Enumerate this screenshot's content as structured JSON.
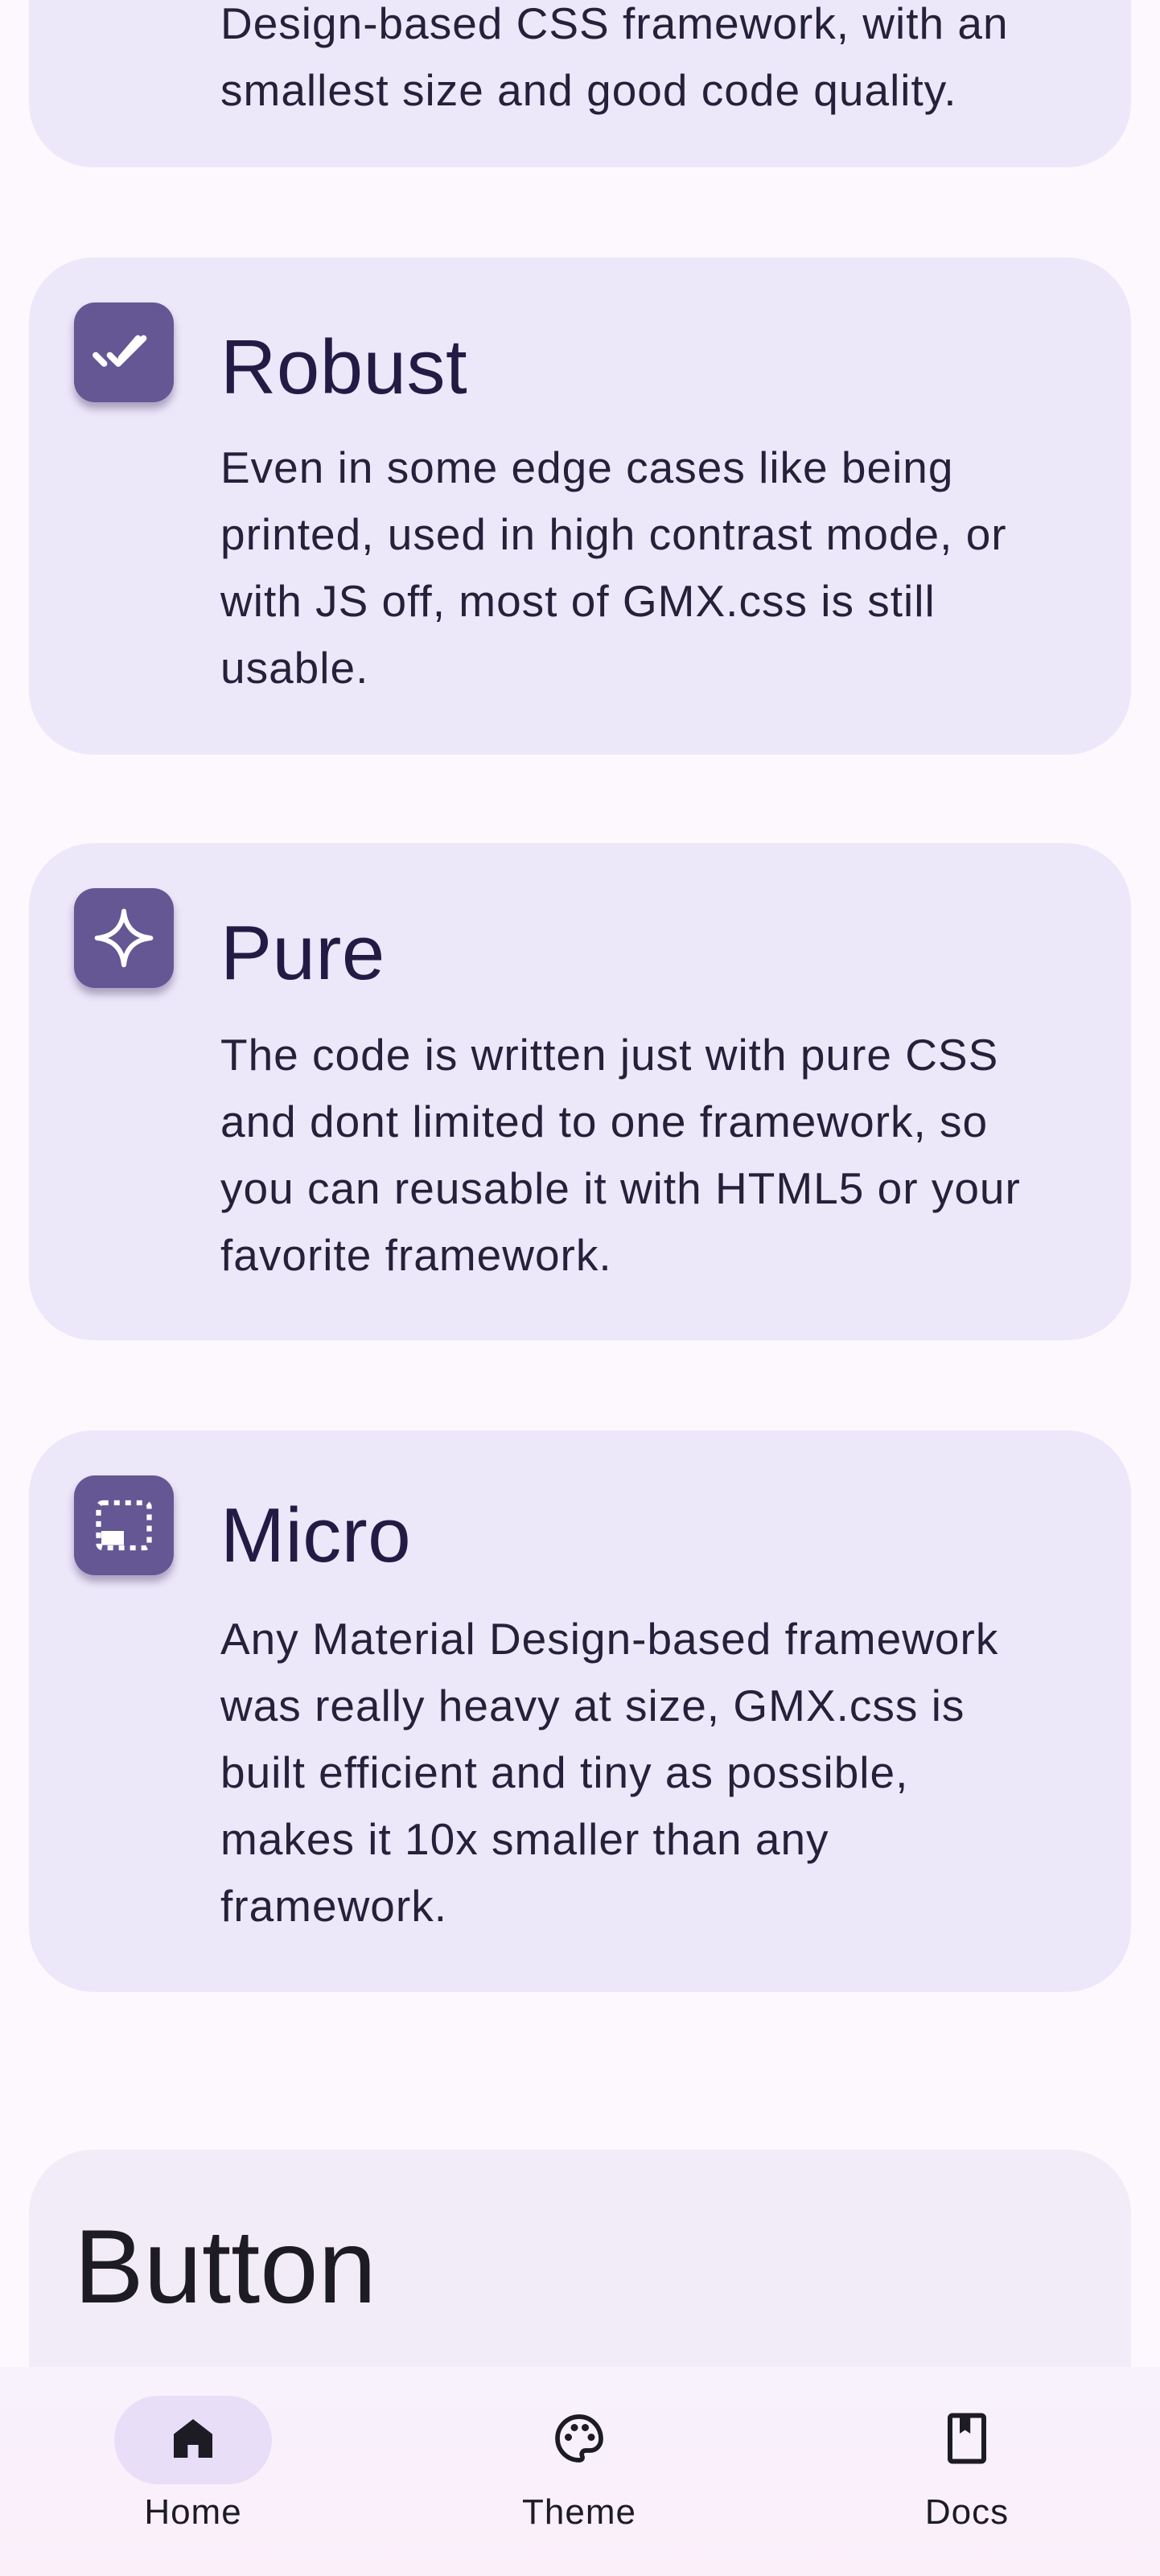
{
  "cards": [
    {
      "id": "intro",
      "lines": [
        "Design-based CSS framework, with an",
        "smallest size and good code quality."
      ]
    },
    {
      "id": "robust",
      "icon": "done-all-icon",
      "title": "Robust",
      "lines": [
        "Even in some edge cases like being",
        "printed, used in high contrast mode, or",
        "with JS off, most of GMX.css is still",
        "usable."
      ]
    },
    {
      "id": "pure",
      "icon": "sparkle-icon",
      "title": "Pure",
      "lines": [
        "The code is written just with pure CSS",
        "and dont limited to one framework, so",
        "you can reusable it with HTML5 or your",
        "favorite framework."
      ]
    },
    {
      "id": "micro",
      "icon": "picture-in-picture-icon",
      "title": "Micro",
      "lines": [
        "Any Material Design-based framework",
        "was really heavy at size, GMX.css is",
        "built efficient and tiny as possible,",
        "makes it 10x smaller than any",
        "framework."
      ]
    }
  ],
  "button_section": {
    "heading": "Button"
  },
  "nav": {
    "items": [
      {
        "label": "Home",
        "icon": "home-icon",
        "active": true
      },
      {
        "label": "Theme",
        "icon": "palette-icon",
        "active": false
      },
      {
        "label": "Docs",
        "icon": "book-icon",
        "active": false
      }
    ]
  },
  "colors": {
    "card_bg": "#ede7fa",
    "icon_bg": "#655694",
    "active_pill": "#e8def8",
    "page_bg": "#fdf8fe"
  }
}
